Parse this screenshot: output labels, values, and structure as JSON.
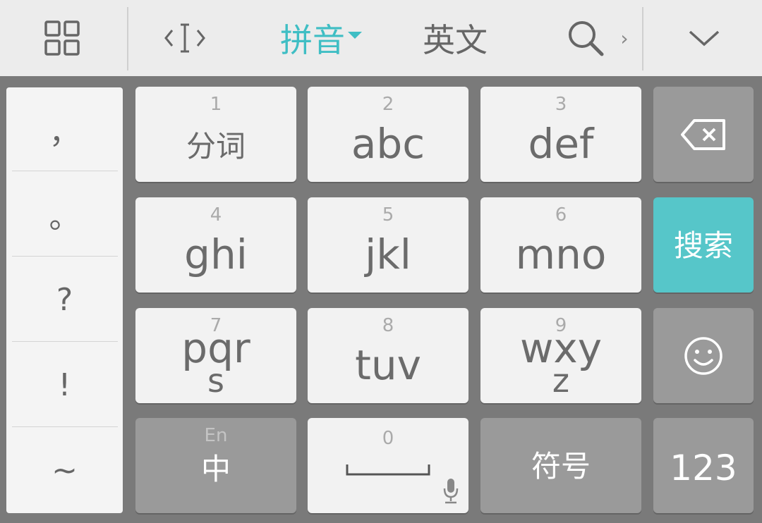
{
  "toolbar": {
    "menu_icon": "grid-icon",
    "cursor_icon": "cursor-icon",
    "pinyin_label": "拼音",
    "english_label": "英文",
    "search_icon": "search-icon",
    "more_chevron": "›",
    "collapse_icon": "chevron-down-icon",
    "accent_color": "#3fbec4"
  },
  "sidebar": {
    "symbols": [
      "，",
      "。",
      "?",
      "!",
      "~"
    ]
  },
  "keys": {
    "row1": [
      {
        "num": "1",
        "label": "分词"
      },
      {
        "num": "2",
        "label": "abc"
      },
      {
        "num": "3",
        "label": "def"
      }
    ],
    "row2": [
      {
        "num": "4",
        "label": "ghi"
      },
      {
        "num": "5",
        "label": "jkl"
      },
      {
        "num": "6",
        "label": "mno"
      }
    ],
    "row3": [
      {
        "num": "7",
        "label": "pqr",
        "label2": "s"
      },
      {
        "num": "8",
        "label": "tuv"
      },
      {
        "num": "9",
        "label": "wxy",
        "label2": "z"
      }
    ],
    "bottom": {
      "lang_small": "En",
      "lang_main": "中",
      "space_num": "0",
      "symbol_label": "符号",
      "numeric_label": "123"
    },
    "right": {
      "delete_icon": "backspace-icon",
      "search_label": "搜索",
      "emoji_icon": "smiley-icon"
    }
  }
}
